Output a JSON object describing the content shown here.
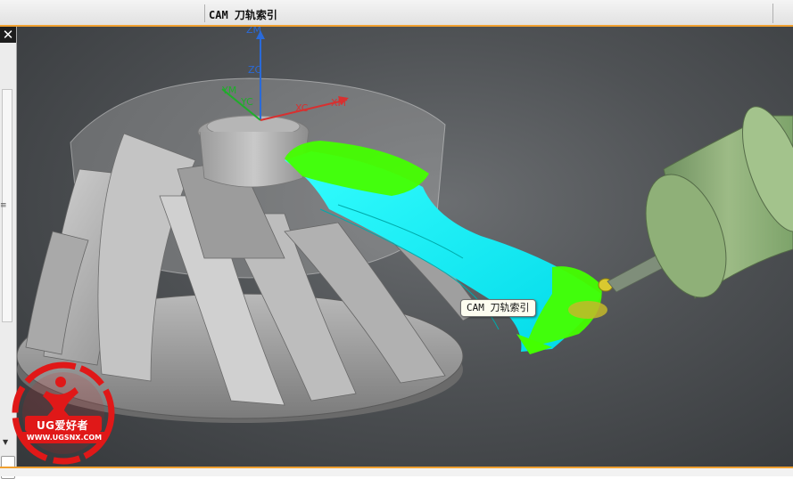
{
  "window": {
    "title": "CAM 刀轨索引"
  },
  "left_panel": {
    "close_glyph": "✕",
    "grip_glyph": "≡",
    "arrow_down_glyph": "▼"
  },
  "viewport": {
    "tooltip": "CAM 刀轨索引",
    "axes": {
      "zm": "ZM",
      "zc": "ZC",
      "ym": "YM",
      "yc": "YC",
      "xc": "XC",
      "xm": "XM"
    },
    "colors": {
      "axis_z": "#2a6ad8",
      "axis_y": "#1fae2a",
      "axis_x": "#d83030",
      "toolpath_cyan": "#19f0f0",
      "toolpath_green": "#44ff00",
      "tool_body": "#8fb078"
    }
  },
  "watermark": {
    "brand": "UG爱好者",
    "url": "WWW.UGSNX.COM",
    "color": "#e01818"
  }
}
